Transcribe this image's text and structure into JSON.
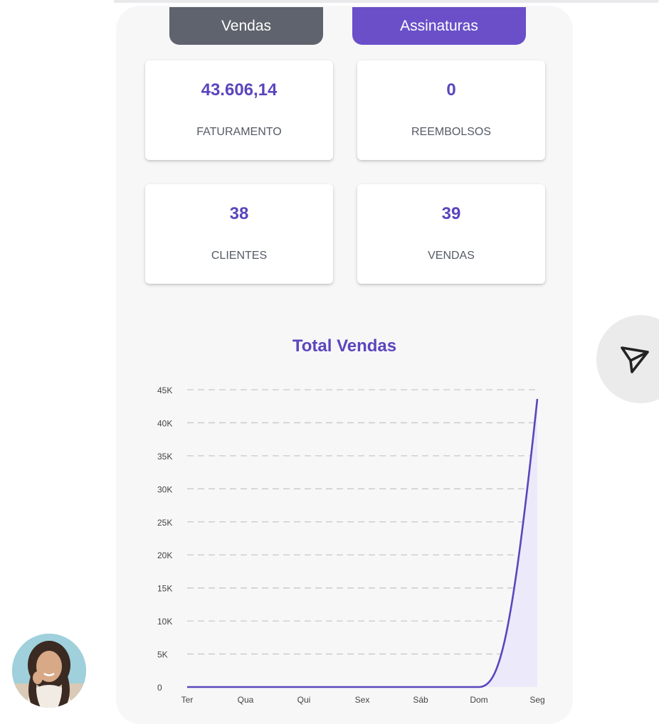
{
  "tabs": {
    "vendas": "Vendas",
    "assinaturas": "Assinaturas"
  },
  "stats": [
    {
      "value": "43.606,14",
      "label": "FATURAMENTO"
    },
    {
      "value": "0",
      "label": "REEMBOLSOS"
    },
    {
      "value": "38",
      "label": "CLIENTES"
    },
    {
      "value": "39",
      "label": "VENDAS"
    }
  ],
  "icons": {
    "fab": "send-icon",
    "avatar": "user-avatar-photo"
  },
  "colors": {
    "accent": "#5b45bd",
    "tab_inactive": "#5f636d",
    "tab_active": "#6a4fc9",
    "line": "#5b45bd",
    "area": "#ece9fa"
  },
  "chart_data": {
    "type": "area",
    "title": "Total Vendas",
    "categories": [
      "Ter",
      "Qua",
      "Qui",
      "Sex",
      "Sáb",
      "Dom",
      "Seg"
    ],
    "values": [
      0,
      0,
      0,
      0,
      0,
      0,
      43606.14
    ],
    "y_ticks": [
      "0",
      "5K",
      "10K",
      "15K",
      "20K",
      "25K",
      "30K",
      "35K",
      "40K",
      "45K"
    ],
    "ylim": [
      0,
      45000
    ],
    "grid": true,
    "grid_style": "dashed",
    "curve": "smooth"
  }
}
